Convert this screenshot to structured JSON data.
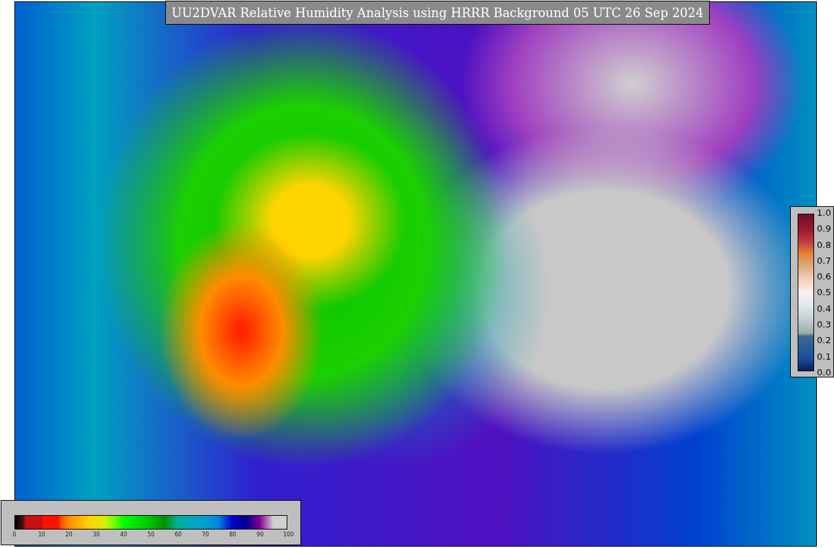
{
  "title": "UU2DVAR Relative Humidity Analysis using HRRR Background 05 UTC 26 Sep 2024",
  "humidity_colorbar": {
    "ticks": [
      "0",
      "10",
      "20",
      "30",
      "40",
      "50",
      "60",
      "70",
      "80",
      "90",
      "100"
    ]
  },
  "observation_colorbar": {
    "ticks": [
      "1.0",
      "0.9",
      "0.8",
      "0.7",
      "0.6",
      "0.5",
      "0.4",
      "0.3",
      "0.2",
      "0.1",
      "0.0"
    ]
  }
}
